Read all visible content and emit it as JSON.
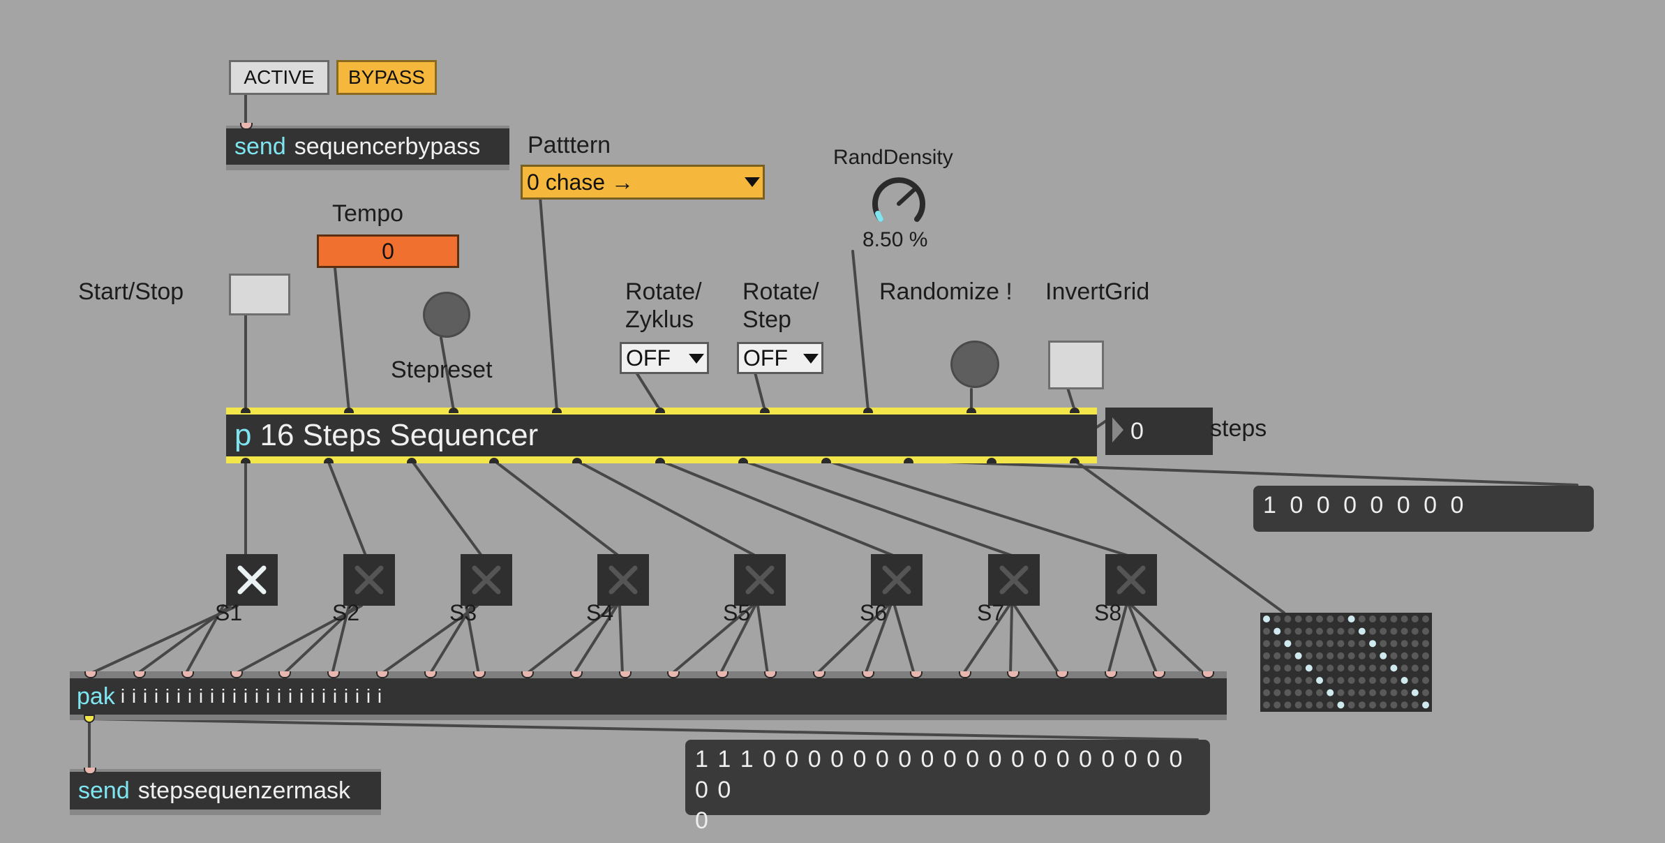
{
  "bypass_controls": {
    "active_label": "ACTIVE",
    "bypass_label": "BYPASS"
  },
  "send_bypass": {
    "keyword": "send",
    "name": "sequencerbypass"
  },
  "pattern": {
    "label": "Patttern",
    "selected": "0 chase →"
  },
  "tempo": {
    "label": "Tempo",
    "value": "0"
  },
  "rand_density": {
    "label": "RandDensity",
    "value": "8.50 %",
    "level": 0.085
  },
  "start_stop": {
    "label": "Start/Stop"
  },
  "stepreset": {
    "label": "Stepreset"
  },
  "rotate_zyklus": {
    "label_line1": "Rotate/",
    "label_line2": "Zyklus",
    "selected": "OFF"
  },
  "rotate_step": {
    "label_line1": "Rotate/",
    "label_line2": "Step",
    "selected": "OFF"
  },
  "randomize": {
    "label": "Randomize !"
  },
  "invert_grid": {
    "label": "InvertGrid"
  },
  "sequencer": {
    "keyword": "p",
    "name": "16 Steps Sequencer"
  },
  "steps_number": {
    "value": "0",
    "label": "steps"
  },
  "step_mask_message": {
    "text": "1 0 0 0 0 0 0 0"
  },
  "steps": [
    {
      "label": "S1",
      "active": true
    },
    {
      "label": "S2",
      "active": false
    },
    {
      "label": "S3",
      "active": false
    },
    {
      "label": "S4",
      "active": false
    },
    {
      "label": "S5",
      "active": false
    },
    {
      "label": "S6",
      "active": false
    },
    {
      "label": "S7",
      "active": false
    },
    {
      "label": "S8",
      "active": false
    }
  ],
  "pak": {
    "keyword": "pak",
    "args": "i i i i i i i i i i i i i i i i i i i i i i i i"
  },
  "send_mask": {
    "keyword": "send",
    "name": "stepsequenzermask"
  },
  "output_message": {
    "line1": "1 1 1 0 0 0 0 0 0 0 0 0 0 0 0 0 0 0 0 0 0 0 0 0",
    "line2": "0"
  },
  "colors": {
    "accent_yellow": "#f5b83d",
    "tempo_orange": "#f07030",
    "keyword_cyan": "#7fe6f1",
    "patch_cord": "#474747"
  }
}
